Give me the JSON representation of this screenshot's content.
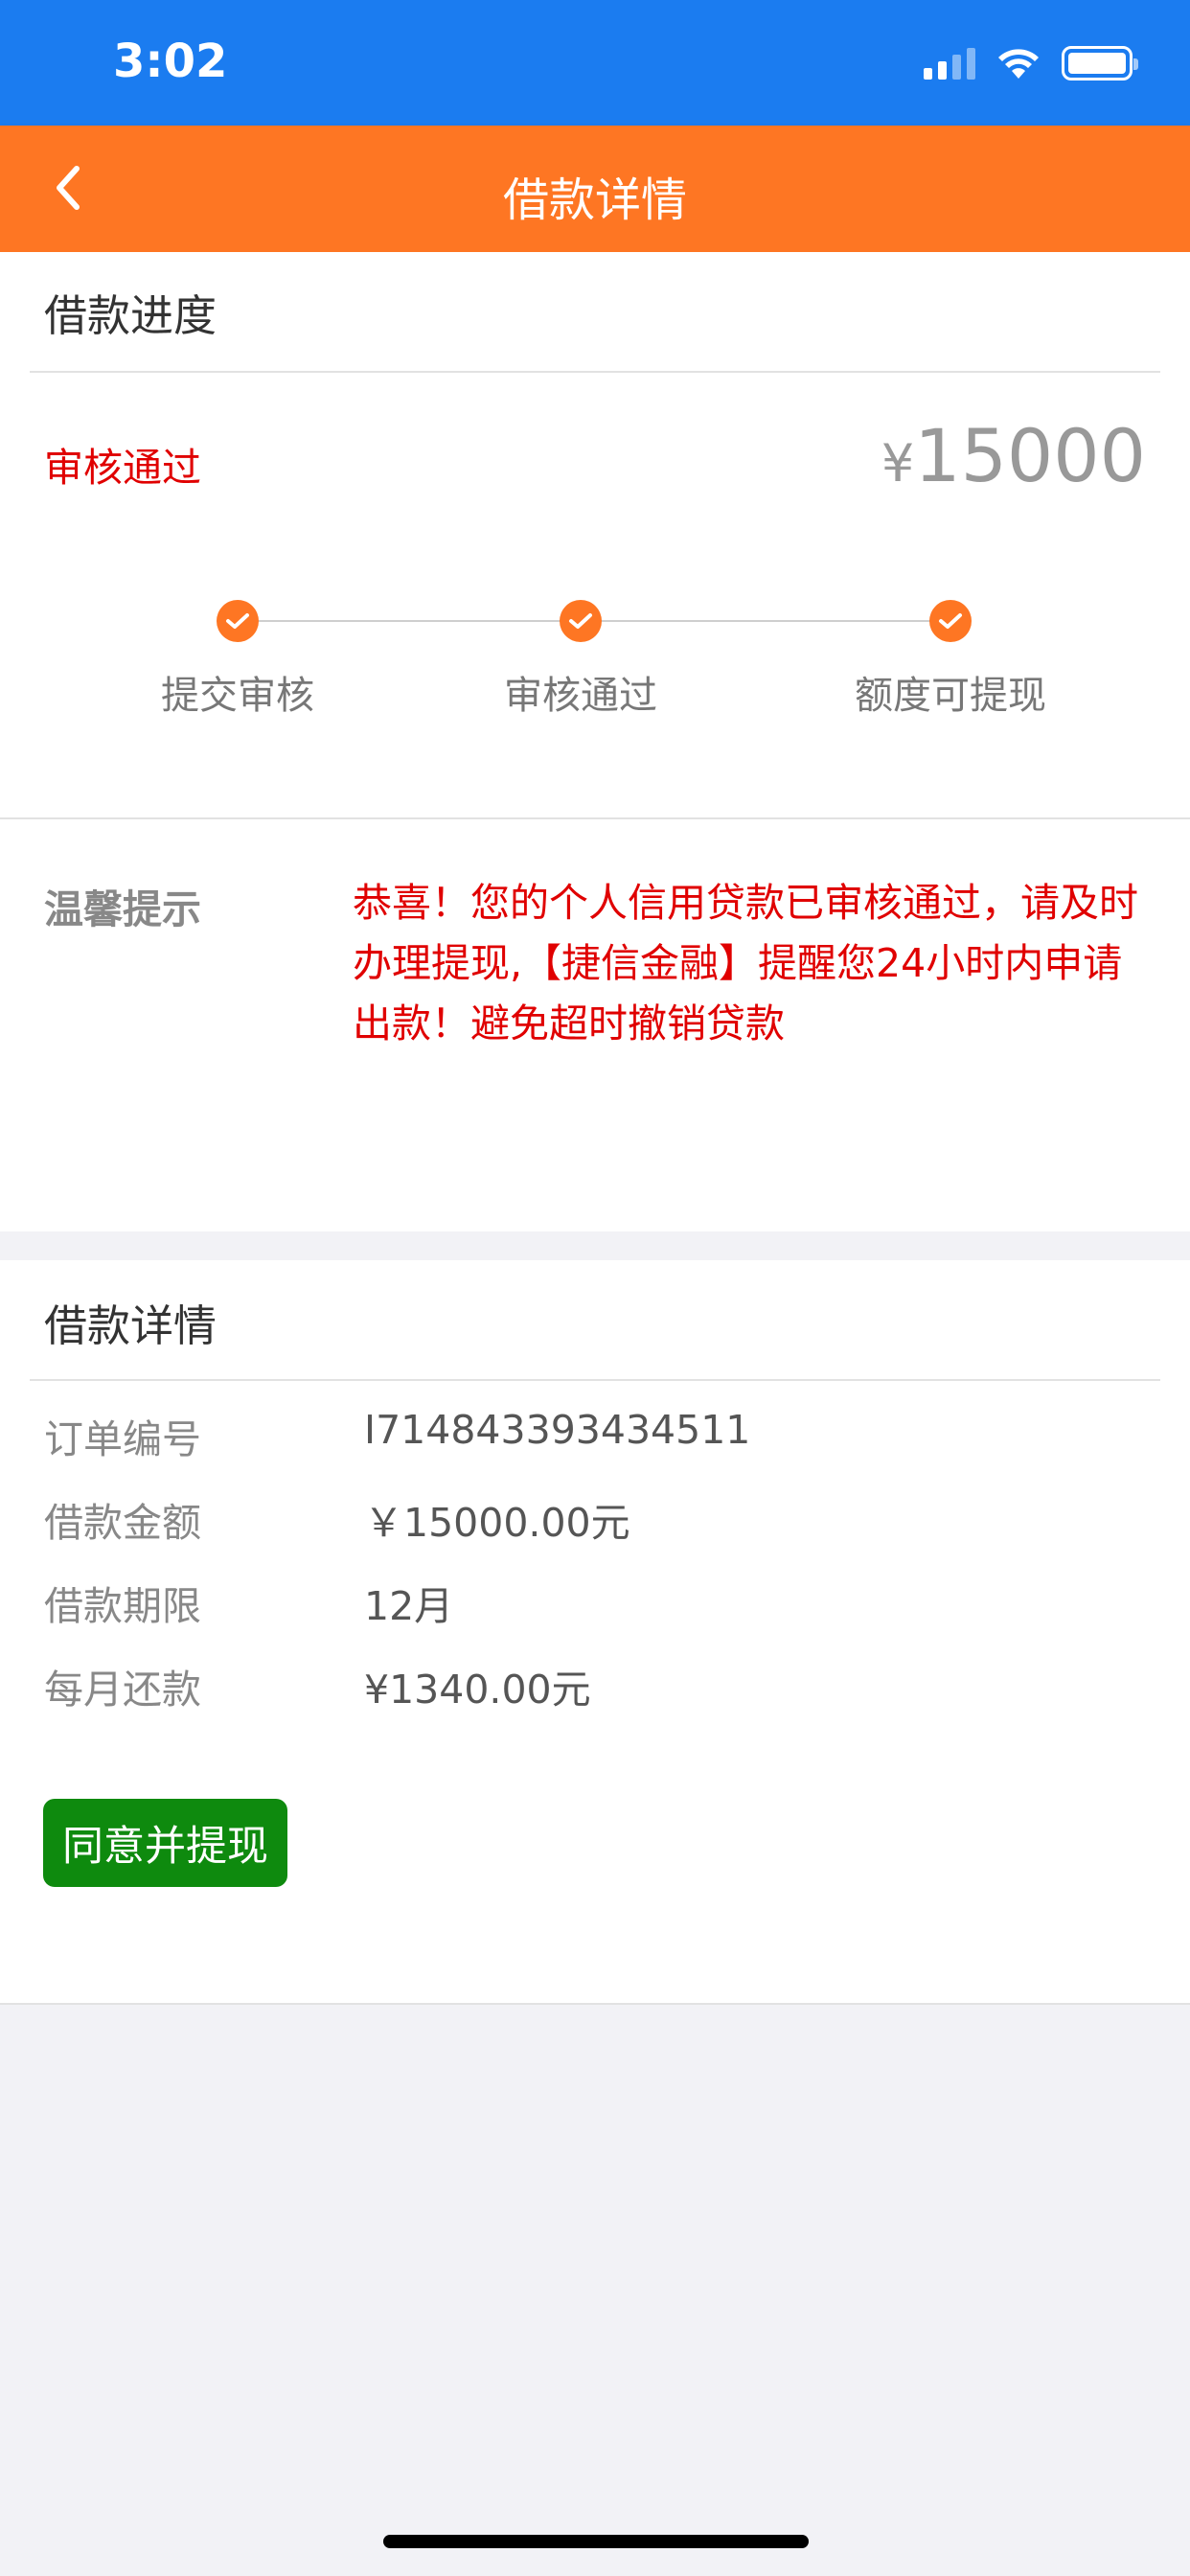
{
  "status_bar": {
    "time": "3:02"
  },
  "nav": {
    "title": "借款详情"
  },
  "progress": {
    "title": "借款进度",
    "status": "审核通过",
    "currency": "¥",
    "amount": "15000",
    "steps": [
      {
        "label": "提交审核"
      },
      {
        "label": "审核通过"
      },
      {
        "label": "额度可提现"
      }
    ]
  },
  "tip": {
    "label": "温馨提示",
    "text": "恭喜！您的个人信用贷款已审核通过，请及时办理提现,【捷信金融】提醒您24小时内申请出款！避免超时撤销贷款"
  },
  "details": {
    "title": "借款详情",
    "rows": [
      {
        "label": "订单编号",
        "value": "I714843393434511"
      },
      {
        "label": "借款金额",
        "value": "￥15000.00元"
      },
      {
        "label": "借款期限",
        "value": "12月"
      },
      {
        "label": "每月还款",
        "value": "¥1340.00元"
      }
    ],
    "confirm_label": "同意并提现"
  },
  "colors": {
    "status_bar": "#1b7cf0",
    "nav_bar": "#fe7623",
    "alert_red": "#e00000",
    "button_green": "#0e8a0e"
  }
}
